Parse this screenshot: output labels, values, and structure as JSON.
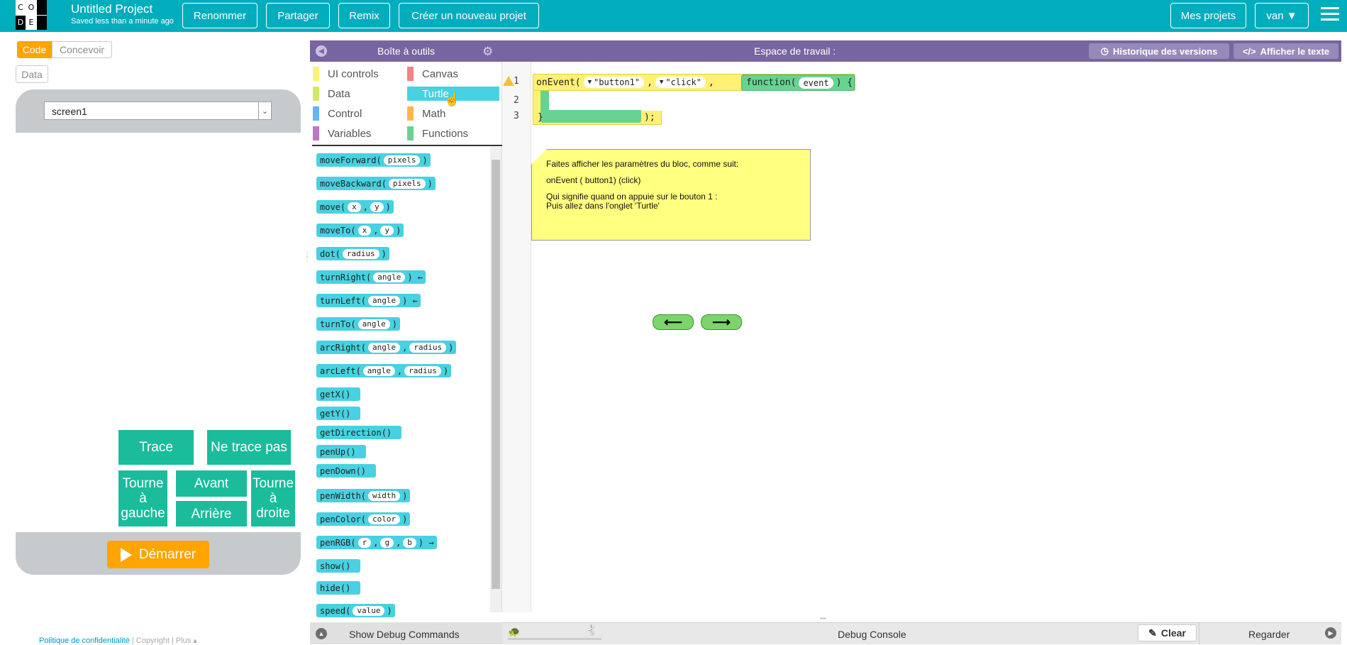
{
  "header": {
    "logo_letters": [
      "C",
      "O",
      "D",
      "E"
    ],
    "project_title": "Untitled Project",
    "saved_status": "Saved less than a minute ago",
    "buttons": {
      "rename": "Renommer",
      "share": "Partager",
      "remix": "Remix",
      "new_project": "Créer un nouveau projet",
      "my_projects": "Mes projets",
      "user": "van ▼"
    }
  },
  "left": {
    "tabs": {
      "code": "Code",
      "design": "Concevoir",
      "data": "Data"
    },
    "screen_select": "screen1",
    "app_buttons": {
      "trace": "Trace",
      "no_trace": "Ne trace pas",
      "turn_left": "Tourne à gauche",
      "forward": "Avant",
      "turn_right": "Tourne à droite",
      "backward": "Arrière"
    },
    "run": "Démarrer",
    "footer": {
      "privacy": "Politique de confidentialité",
      "sep1": "|",
      "copyright": "Copyright",
      "sep2": "|",
      "more": "Plus ▴"
    }
  },
  "toolbox": {
    "title": "Boîte à outils",
    "categories": [
      {
        "label": "UI controls",
        "color": "#fff176"
      },
      {
        "label": "Canvas",
        "color": "#f78183"
      },
      {
        "label": "Data",
        "color": "#d3e965"
      },
      {
        "label": "Turtle",
        "color": "#48d1e1"
      },
      {
        "label": "Control",
        "color": "#64b5f6"
      },
      {
        "label": "Math",
        "color": "#ffb74d"
      },
      {
        "label": "Variables",
        "color": "#bb77c7"
      },
      {
        "label": "Functions",
        "color": "#68d391"
      }
    ],
    "blocks": [
      {
        "name": "moveForward(",
        "params": [
          "pixels"
        ],
        "tail": ")"
      },
      {
        "name": "moveBackward(",
        "params": [
          "pixels"
        ],
        "tail": ")"
      },
      {
        "name": "move(",
        "params": [
          "x",
          "y"
        ],
        "tail": ")"
      },
      {
        "name": "moveTo(",
        "params": [
          "x",
          "y"
        ],
        "tail": ")"
      },
      {
        "name": "dot(",
        "params": [
          "radius"
        ],
        "tail": ")"
      },
      {
        "name": "turnRight(",
        "params": [
          "angle"
        ],
        "tail": ") ←"
      },
      {
        "name": "turnLeft(",
        "params": [
          "angle"
        ],
        "tail": ") ←"
      },
      {
        "name": "turnTo(",
        "params": [
          "angle"
        ],
        "tail": ")"
      },
      {
        "name": "arcRight(",
        "params": [
          "angle",
          "radius"
        ],
        "tail": ")"
      },
      {
        "name": "arcLeft(",
        "params": [
          "angle",
          "radius"
        ],
        "tail": ")"
      },
      {
        "name": "getX()",
        "params": [],
        "tail": ""
      },
      {
        "name": "getY()",
        "params": [],
        "tail": ""
      },
      {
        "name": "getDirection()",
        "params": [],
        "tail": ""
      },
      {
        "name": "penUp()",
        "params": [],
        "tail": ""
      },
      {
        "name": "penDown()",
        "params": [],
        "tail": ""
      },
      {
        "name": "penWidth(",
        "params": [
          "width"
        ],
        "tail": ")"
      },
      {
        "name": "penColor(",
        "params": [
          "color"
        ],
        "tail": ")"
      },
      {
        "name": "penRGB(",
        "params": [
          "r",
          "g",
          "b"
        ],
        "tail": ") →"
      },
      {
        "name": "show()",
        "params": [],
        "tail": ""
      },
      {
        "name": "hide()",
        "params": [],
        "tail": ""
      },
      {
        "name": "speed(",
        "params": [
          "value"
        ],
        "tail": ")"
      }
    ]
  },
  "workspace": {
    "title": "Espace de travail :",
    "version_history": "Historique des versions",
    "show_text": "Afficher le texte",
    "line_numbers": [
      "1",
      "2",
      "3"
    ],
    "code": {
      "on_event": "onEvent(",
      "element_id": "\"button1\"",
      "event_type": "\"click\"",
      "comma": ",",
      "function_kw": "function(",
      "event_param": "event",
      "open_brace": ") {",
      "close_brace": "}",
      "close_paren": ");"
    },
    "note": {
      "line1": "Faites afficher les paramètres du bloc, comme suit:",
      "line2": "onEvent  ( button1)  (click)",
      "line3": "Qui signifie quand on appuie sur le bouton 1 :",
      "line4": "Puis allez dans l'onglet 'Turtle'"
    },
    "nav": {
      "prev": "⟵",
      "next": "⟶"
    }
  },
  "debug": {
    "show_commands": "Show Debug Commands",
    "console": "Debug Console",
    "clear": "Clear",
    "watch": "Regarder"
  },
  "colors": {
    "header": "#00adbc",
    "accent": "#ffa400",
    "purple": "#7665a0",
    "app_button": "#1abc9c"
  }
}
